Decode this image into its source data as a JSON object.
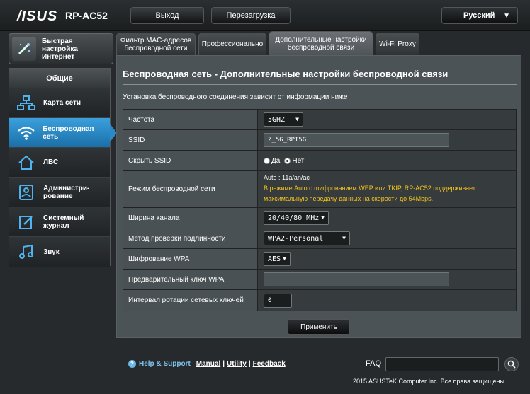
{
  "header": {
    "logo": "/ISUS",
    "model": "RP-AC52",
    "logout_label": "Выход",
    "reboot_label": "Перезагрузка",
    "language": "Русский"
  },
  "sidebar": {
    "quick_setup": "Быстрая настройка Интернет",
    "section_title": "Общие",
    "items": [
      {
        "label": "Карта сети",
        "icon": "network-map-icon"
      },
      {
        "label": "Беспроводная сеть",
        "icon": "wifi-icon",
        "active": true
      },
      {
        "label": "ЛВС",
        "icon": "home-icon"
      },
      {
        "label": "Администри-рование",
        "icon": "user-icon"
      },
      {
        "label": "Системный журнал",
        "icon": "log-icon"
      },
      {
        "label": "Звук",
        "icon": "music-icon"
      }
    ]
  },
  "tabs": [
    {
      "label": "Фильтр MAC-адресов беспроводной сети"
    },
    {
      "label": "Профессионально"
    },
    {
      "label": "Дополнительные настройки беспроводной связи",
      "active": true
    },
    {
      "label": "Wi-Fi Proxy"
    }
  ],
  "main": {
    "title": "Беспроводная сеть - Дополнительные настройки беспроводной связи",
    "description": "Установка беспроводного соединения зависит от информации ниже",
    "fields": {
      "frequency": {
        "label": "Частота",
        "value": "5GHZ"
      },
      "ssid": {
        "label": "SSID",
        "value": "Z_5G_RPT5G"
      },
      "hide_ssid": {
        "label": "Скрыть SSID",
        "yes": "Да",
        "no": "Нет"
      },
      "wireless_mode": {
        "label": "Режим беспроводной сети",
        "value": "Auto : 11a/an/ac",
        "warning": "В режиме Auto с шифрованием WEP или TKIP, RP-AC52 поддерживает максимальную передачу данных на скорости до 54Mbps."
      },
      "channel_width": {
        "label": "Ширина канала",
        "value": "20/40/80 MHz"
      },
      "auth_method": {
        "label": "Метод проверки подлинности",
        "value": "WPA2-Personal"
      },
      "wpa_encryption": {
        "label": "Шифрование WPA",
        "value": "AES"
      },
      "wpa_key": {
        "label": "Предварительный ключ WPA",
        "value": ""
      },
      "key_rotation": {
        "label": "Интервал ротации сетевых ключей",
        "value": "0"
      }
    },
    "apply_label": "Применить"
  },
  "footer": {
    "help_support": "Help & Support",
    "manual": "Manual",
    "utility": "Utility",
    "feedback": "Feedback",
    "faq": "FAQ",
    "copyright": "2015 ASUSTeK Computer Inc. Все права защищены."
  },
  "colors": {
    "accent": "#2b89c5",
    "warning_text": "#f5c21b",
    "panel_bg": "#4c5356"
  }
}
